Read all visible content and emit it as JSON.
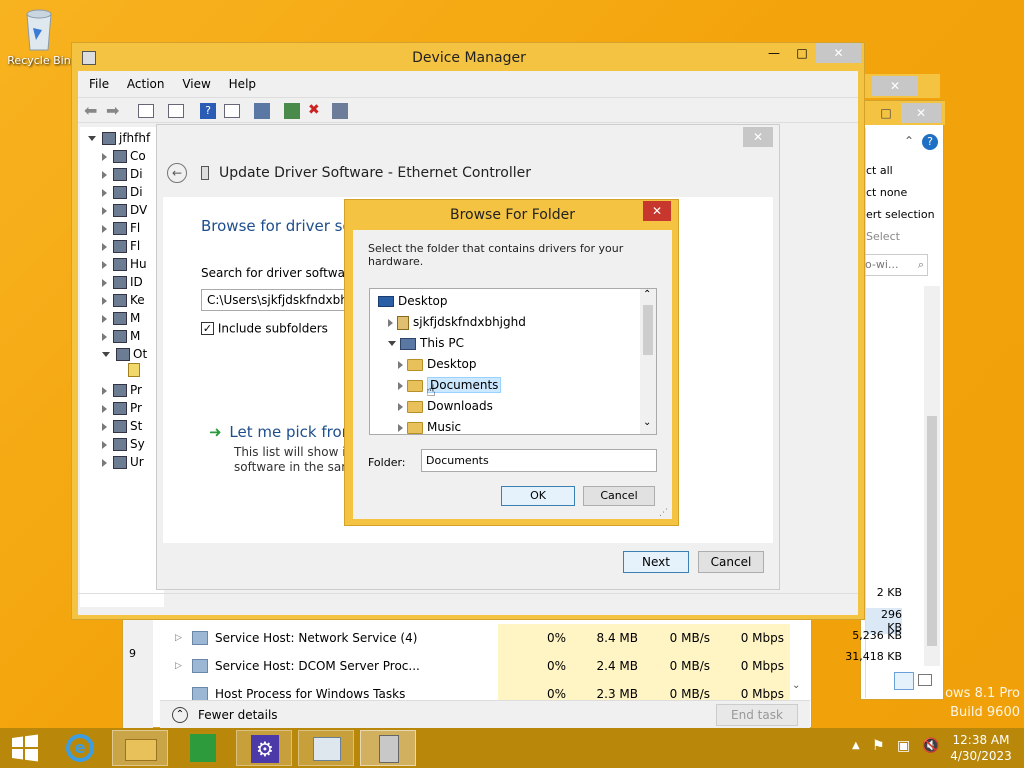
{
  "desktop": {
    "recycle_bin_label": "Recycle Bin",
    "watermark_line1": "ows 8.1 Pro",
    "watermark_line2": "Build 9600"
  },
  "device_manager": {
    "title": "Device Manager",
    "menu": [
      "File",
      "Action",
      "View",
      "Help"
    ],
    "tree_root": "jfhfhf",
    "tree_items": [
      "Co",
      "Di",
      "Di",
      "DV",
      "Fl",
      "Fl",
      "Hu",
      "ID",
      "Ke",
      "M",
      "M",
      "Ot",
      "Pr",
      "Pr",
      "St",
      "Sy",
      "Ur"
    ]
  },
  "update_driver": {
    "title": "Update Driver Software - Ethernet Controller",
    "heading": "Browse for driver sof",
    "search_label": "Search for driver software in",
    "path_value": "C:\\Users\\sjkfjdskfndxbhjgh",
    "include_subfolders": "Include subfolders",
    "let_me_pick": "Let me pick from",
    "let_me_pick_desc1": "This list will show inst",
    "let_me_pick_desc2": "software in the same",
    "next_button": "Next",
    "cancel_button": "Cancel"
  },
  "browse_dialog": {
    "title": "Browse For Folder",
    "instruction": "Select the folder that contains drivers for your hardware.",
    "tree": [
      {
        "label": "Desktop",
        "level": 0,
        "expander": "none",
        "icon": "desktop-icon"
      },
      {
        "label": "sjkfjdskfndxbhjghd",
        "level": 1,
        "expander": "closed",
        "icon": "user-icon"
      },
      {
        "label": "This PC",
        "level": 1,
        "expander": "open",
        "icon": "computer-icon"
      },
      {
        "label": "Desktop",
        "level": 2,
        "expander": "closed",
        "icon": "folder-icon"
      },
      {
        "label": "Documents",
        "level": 2,
        "expander": "closed",
        "icon": "folder-icon",
        "selected": true
      },
      {
        "label": "Downloads",
        "level": 2,
        "expander": "closed",
        "icon": "folder-icon"
      },
      {
        "label": "Music",
        "level": 2,
        "expander": "closed",
        "icon": "folder-icon"
      }
    ],
    "folder_label": "Folder:",
    "folder_value": "Documents",
    "ok_button": "OK",
    "cancel_button": "Cancel"
  },
  "task_manager": {
    "rows": [
      {
        "name": "Service Host: Network Service (4)",
        "cpu": "0%",
        "memory": "8.4 MB",
        "disk": "0 MB/s",
        "network": "0 Mbps"
      },
      {
        "name": "Service Host: DCOM Server Proc...",
        "cpu": "0%",
        "memory": "2.4 MB",
        "disk": "0 MB/s",
        "network": "0 Mbps"
      },
      {
        "name": "Host Process for Windows Tasks",
        "cpu": "0%",
        "memory": "2.3 MB",
        "disk": "0 MB/s",
        "network": "0 Mbps"
      }
    ],
    "fewer_details": "Fewer details",
    "end_task": "End task"
  },
  "explorer": {
    "ribbon_items": [
      "ct all",
      "ct none",
      "ert selection",
      "Select"
    ],
    "search_placeholder": "o-wi...",
    "sizes": [
      "2 KB",
      "296 KB",
      "5,236 KB",
      "31,418 KB"
    ]
  },
  "taskbar": {
    "time": "12:38 AM",
    "date": "4/30/2023"
  }
}
